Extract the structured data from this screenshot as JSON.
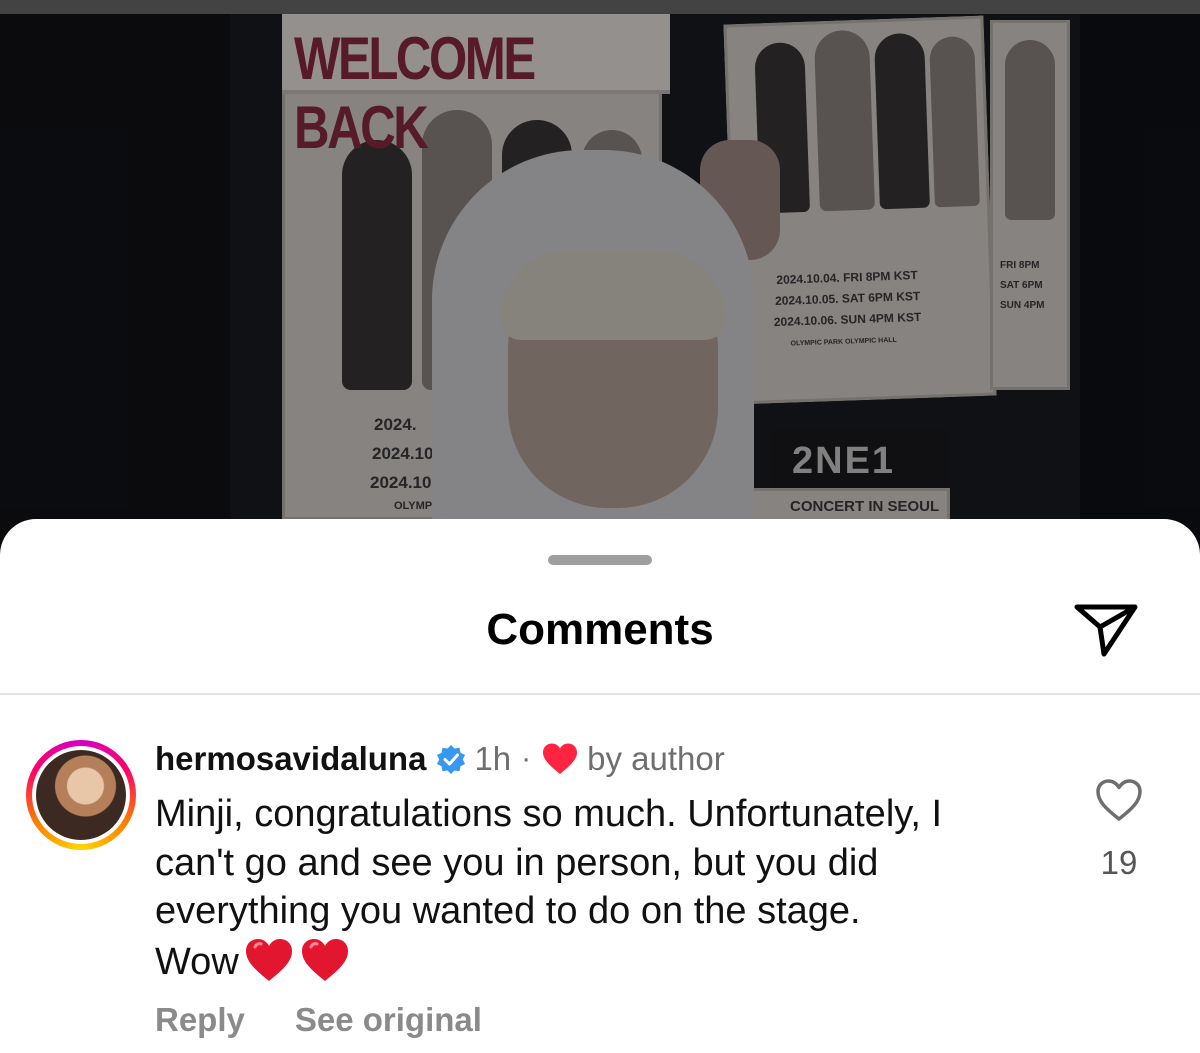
{
  "photo": {
    "banner": "WELCOME BACK",
    "poster_dates": [
      "2024.10.04. FRI 8PM KST",
      "2024.10.05. SAT 6PM KST",
      "2024.10.06. SUN 4PM KST"
    ],
    "poster_venue": "OLYMPIC PARK OLYMPIC HALL",
    "left_poster_dates": [
      "2024.",
      "2024.10.",
      "2024.10.("
    ],
    "left_poster_venue": "OLYMPI",
    "right_poster_lines": [
      "FRI 8PM",
      "SAT 6PM",
      "SUN 4PM"
    ],
    "brand": "2NE1",
    "concert_caption": "CONCERT IN SEOUL"
  },
  "sheet": {
    "title": "Comments",
    "share_icon": "paper-plane-icon"
  },
  "comment": {
    "username": "hermosavidaluna",
    "verified_icon": "verified-badge-icon",
    "time": "1h",
    "separator": "·",
    "author_heart_icon": "heart-filled-icon",
    "author_label": "by author",
    "lines": [
      "Minji, congratulations so much. Unfortunately, I",
      "can't go and see you in person, but you did",
      "everything you wanted to do on the stage.",
      "Wow"
    ],
    "emoji": [
      "red-heart-emoji",
      "red-heart-emoji"
    ],
    "like_icon": "heart-outline-icon",
    "like_count": "19",
    "actions": {
      "reply": "Reply",
      "see_original": "See original"
    }
  },
  "colors": {
    "heart_red": "#ff2542",
    "verified_blue": "#3897f0",
    "secondary_text": "#6e6e6e"
  }
}
